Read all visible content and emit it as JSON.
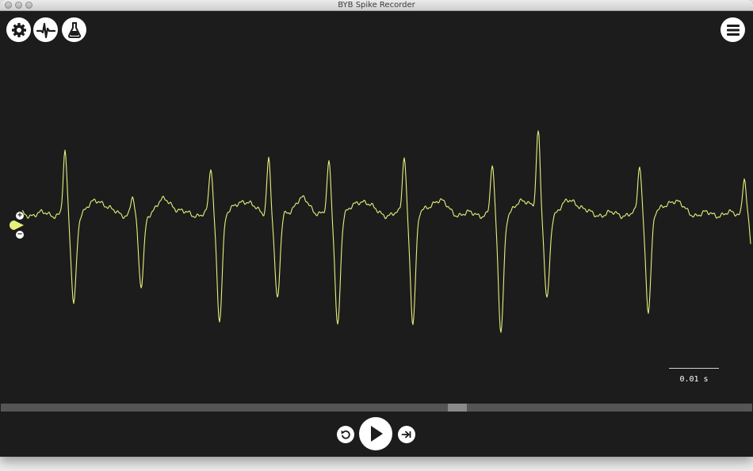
{
  "window": {
    "title": "BYB Spike Recorder"
  },
  "toolbar": {
    "settings_icon": "gear-icon",
    "threshold_icon": "spike-icon",
    "analysis_icon": "flask-icon",
    "menu_icon": "hamburger-icon"
  },
  "gain": {
    "plus": "+",
    "minus": "−"
  },
  "scale": {
    "label": "0.01 s"
  },
  "playback": {
    "position_fraction": 0.61,
    "rewind_icon": "rewind-icon",
    "play_icon": "play-icon",
    "skip_icon": "skip-to-end-icon"
  },
  "colors": {
    "background": "#1c1c1c",
    "trace": "#e6f07a",
    "button": "#ffffff",
    "scrollbar": "#555555",
    "scroll_thumb": "#8a8a8a"
  }
}
